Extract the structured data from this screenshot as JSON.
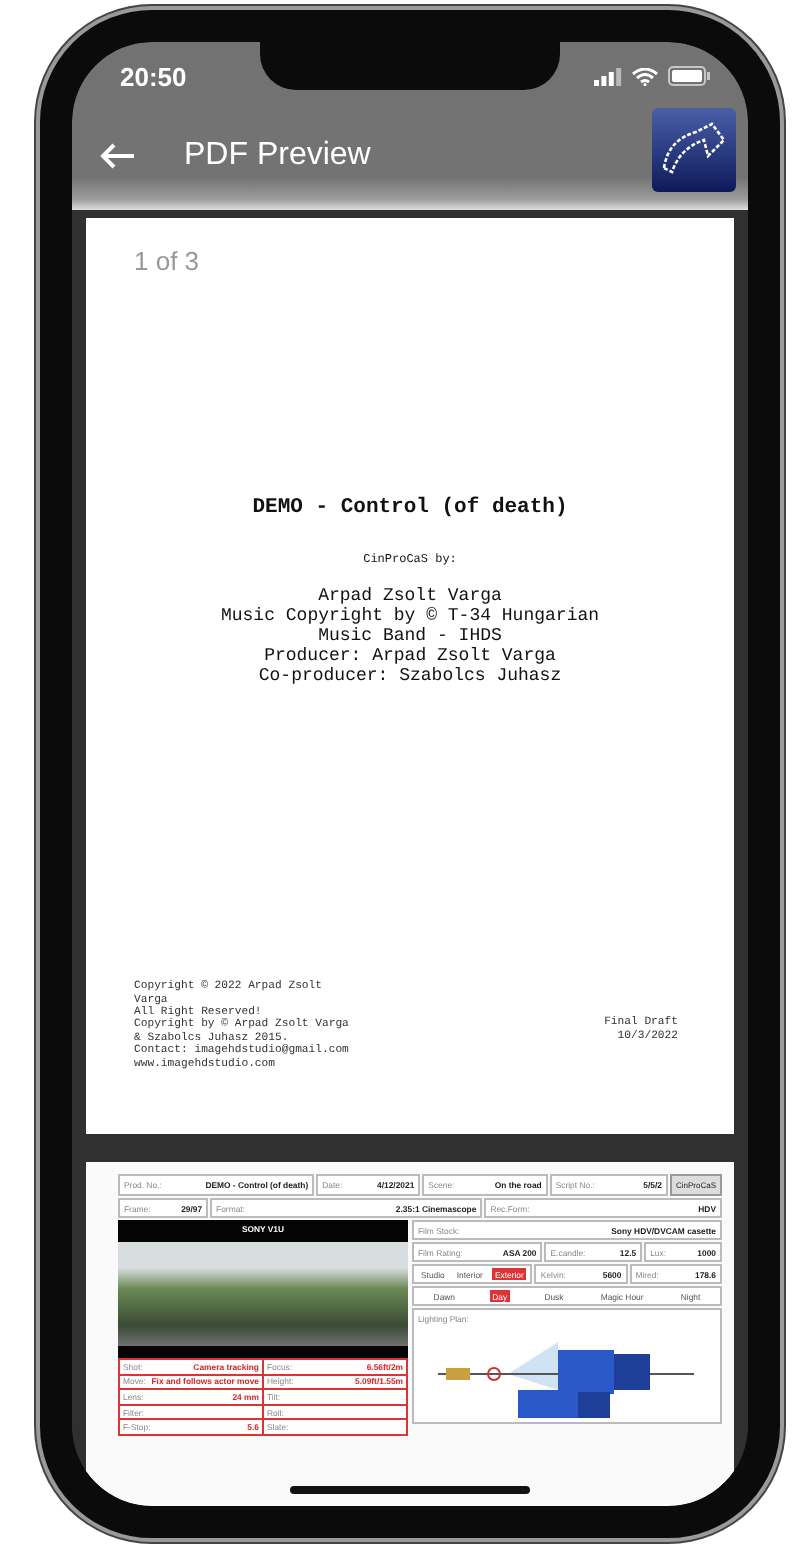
{
  "status_bar": {
    "time": "20:50"
  },
  "header": {
    "title": "PDF Preview"
  },
  "page_1": {
    "page_indicator": "1 of 3",
    "title": "DEMO - Control (of death)",
    "credit_line": "CinProCaS by:",
    "credits": [
      "Arpad Zsolt Varga",
      "Music Copyright by © T-34 Hungarian",
      "Music Band - IHDS",
      "Producer: Arpad Zsolt Varga",
      "Co-producer: Szabolcs Juhasz"
    ],
    "copyright_lines": [
      "Copyright © 2022 Arpad Zsolt",
      "Varga",
      "All Right Reserved!",
      "Copyright by © Arpad Zsolt Varga",
      "& Szabolcs Juhasz 2015.",
      "Contact: imagehdstudio@gmail.com",
      "www.imagehdstudio.com"
    ],
    "draft_label": "Final Draft",
    "draft_date": "10/3/2022"
  },
  "page_2": {
    "row_1": [
      {
        "label": "Prod. No.:",
        "value": "DEMO - Control (of death)"
      },
      {
        "label": "Date:",
        "value": "4/12/2021"
      },
      {
        "label": "Scene:",
        "value": "On the road"
      },
      {
        "label": "Script No.:",
        "value": "5/5/2"
      }
    ],
    "logo": "CinProCaS",
    "row_2": [
      {
        "label": "Frame:",
        "value": "29/97"
      },
      {
        "label": "Format:",
        "value": "2.35:1 Cinemascope"
      },
      {
        "label": "Rec.Form:",
        "value": "HDV"
      }
    ],
    "camera": "SONY V1U",
    "shot_fields": [
      {
        "label": "Shot:",
        "value": "Camera tracking"
      },
      {
        "label": "Move:",
        "value": "Fix and follows actor move"
      },
      {
        "label": "Lens:",
        "value": "24 mm"
      },
      {
        "label": "Filter:"
      },
      {
        "label": "F-Stop:",
        "value": "5.6"
      }
    ],
    "shot_fields_right": [
      {
        "label": "Focus:",
        "value": "6.56ft/2m"
      },
      {
        "label": "Height:",
        "value": "5.09ft/1.55m"
      },
      {
        "label": "Tilt:"
      },
      {
        "label": "Roll:"
      },
      {
        "label": "Slate:"
      }
    ],
    "film_stock": {
      "label": "Film Stock:",
      "value": "Sony HDV/DVCAM casette"
    },
    "exposure": [
      {
        "label": "Film Rating:",
        "value": "ASA 200"
      },
      {
        "label": "E.candle:",
        "value": "12.5"
      },
      {
        "label": "Lux:",
        "value": "1000"
      }
    ],
    "locations": [
      {
        "label": "Studio",
        "selected": false
      },
      {
        "label": "Interior",
        "selected": false
      },
      {
        "label": "Exterior",
        "selected": true
      }
    ],
    "color_temp": [
      {
        "label": "Kelvin:",
        "value": "5600"
      },
      {
        "label": "Mired:",
        "value": "178.6"
      }
    ],
    "times": [
      {
        "label": "Dawn",
        "selected": false
      },
      {
        "label": "Day",
        "selected": true
      },
      {
        "label": "Dusk",
        "selected": false
      },
      {
        "label": "Magic Hour",
        "selected": false
      },
      {
        "label": "Night",
        "selected": false
      }
    ],
    "lighting_plan_label": "Lighting Plan:"
  }
}
